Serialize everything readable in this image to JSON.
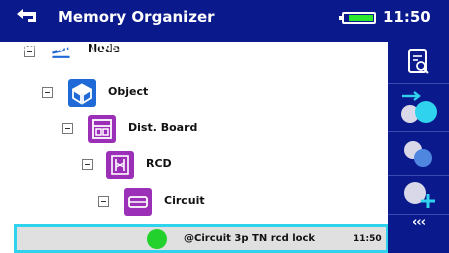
{
  "header": {
    "title": "Memory Organizer",
    "time": "11:50",
    "battery_level": 0.85,
    "breadcrumb": "Node \\ Object \\ Dist. Board \\ RCD \\ Circuit"
  },
  "tree": {
    "nodes": [
      {
        "label": "Node",
        "icon": "node-icon"
      },
      {
        "label": "Object",
        "icon": "object-cube-icon"
      },
      {
        "label": "Dist. Board",
        "icon": "distribution-board-icon"
      },
      {
        "label": "RCD",
        "icon": "rcd-icon"
      },
      {
        "label": "Circuit",
        "icon": "circuit-icon"
      }
    ],
    "selected": {
      "label": "@Circuit 3p TN rcd lock",
      "time": "11:50",
      "status_color": "#22d12c"
    }
  },
  "sidebar": {
    "buttons": [
      {
        "icon": "view-details-icon"
      },
      {
        "icon": "start-test-icon"
      },
      {
        "icon": "clone-icon"
      },
      {
        "icon": "add-node-icon"
      }
    ],
    "more_label": "‹‹‹"
  },
  "colors": {
    "header_bg": "#0a1a8c",
    "accent_cyan": "#2fd3ee",
    "icon_blue": "#1f6ad6",
    "icon_purple": "#9b2fb8",
    "status_green": "#22d12c"
  }
}
